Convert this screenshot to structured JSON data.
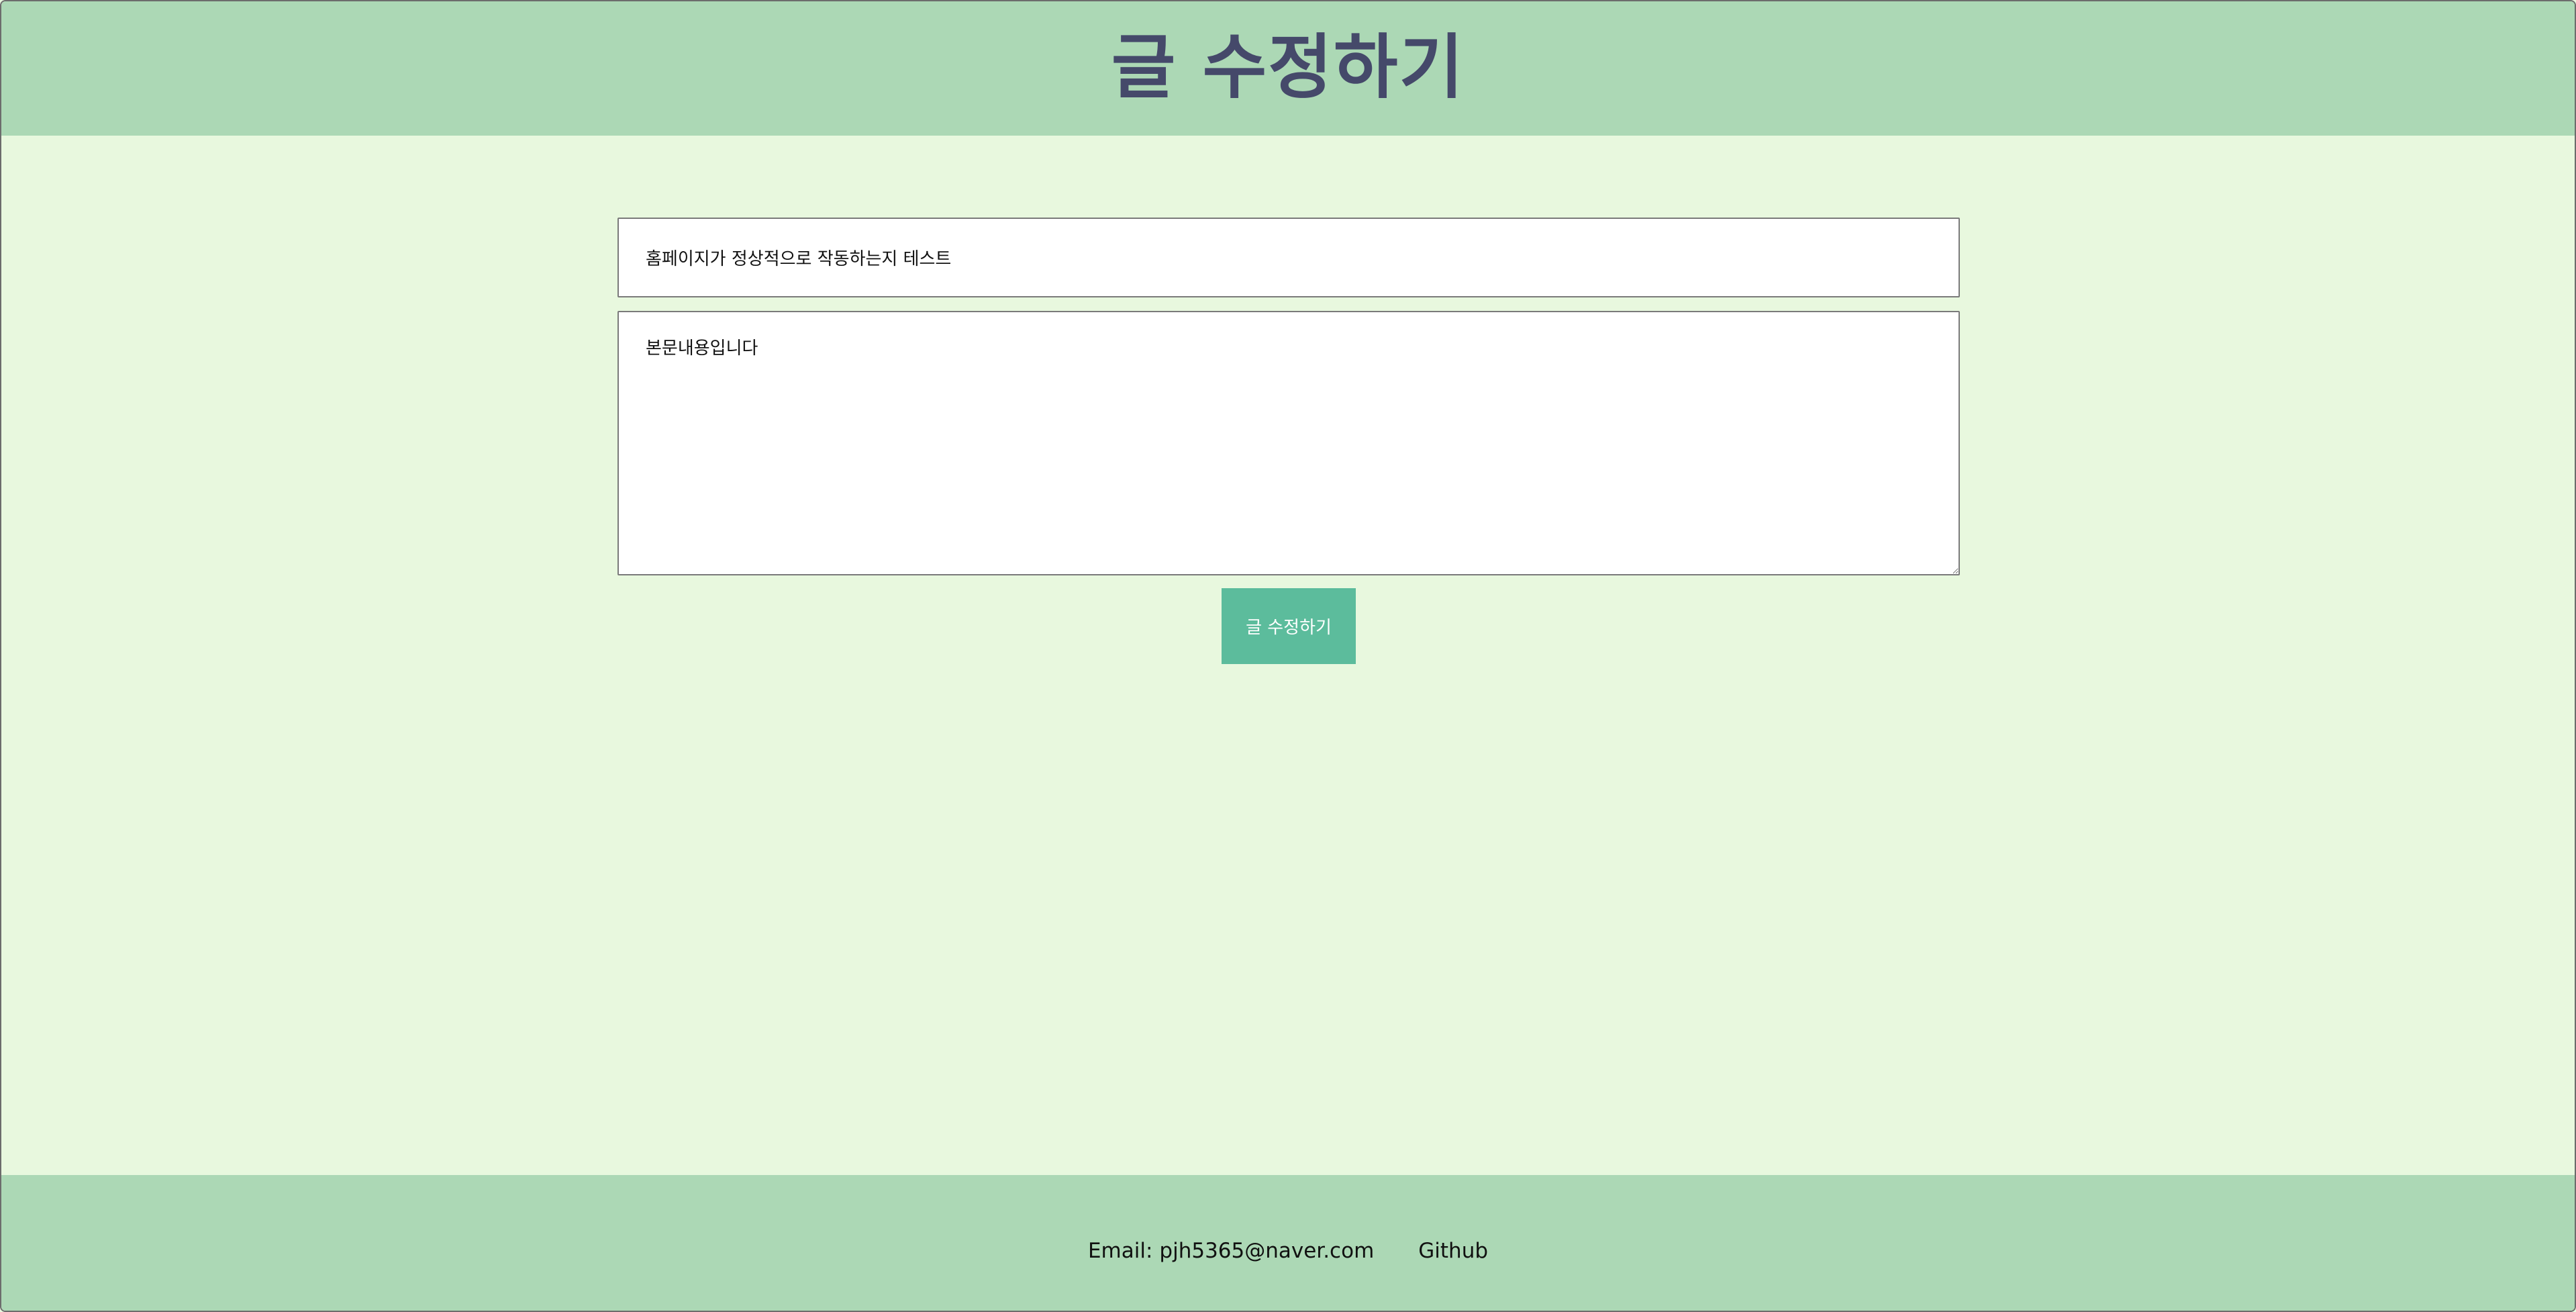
{
  "header": {
    "title": "글 수정하기"
  },
  "form": {
    "title_value": "홈페이지가 정상적으로 작동하는지 테스트",
    "content_value": "본문내용입니다",
    "submit_label": "글 수정하기"
  },
  "footer": {
    "email_label": "Email:",
    "email_value": "pjh5365@naver.com",
    "github_label": "Github"
  },
  "colors": {
    "background": "#e8f8de",
    "header_footer": "#acd8b5",
    "title_text": "#45496a",
    "button": "#5cbc9c"
  }
}
